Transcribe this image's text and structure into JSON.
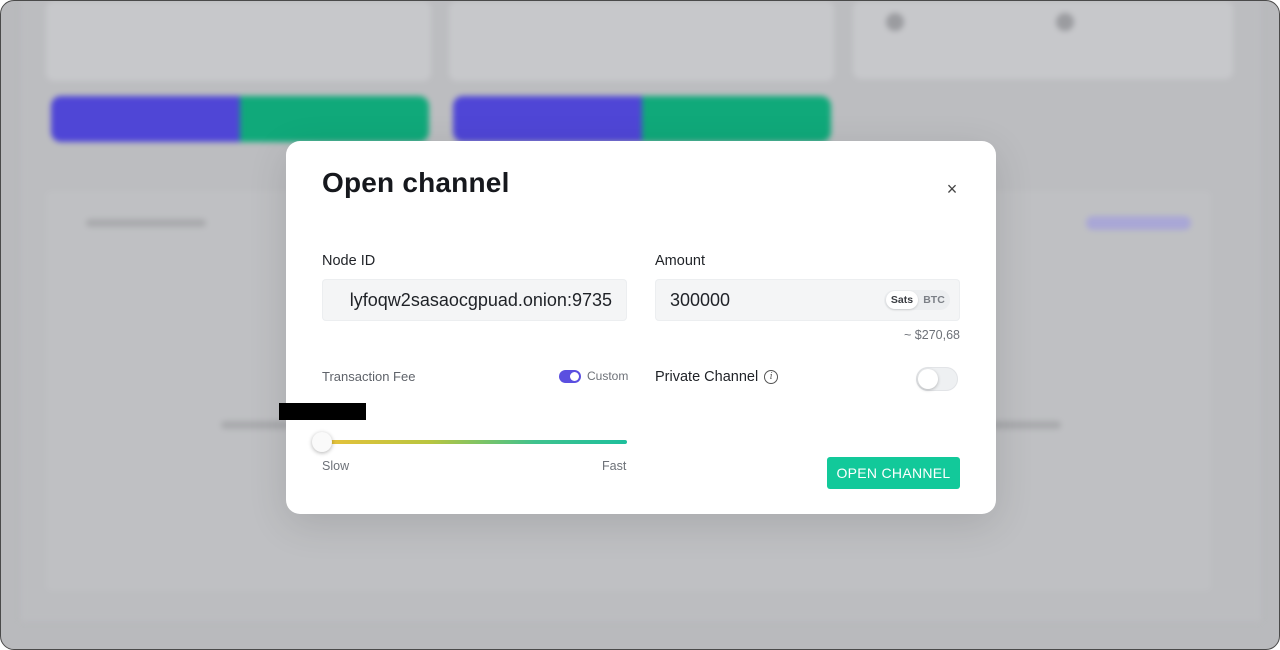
{
  "modal": {
    "title": "Open channel",
    "close_glyph": "×",
    "node_id": {
      "label": "Node ID",
      "value": "lyfoqw2sasaocgpuad.onion:9735"
    },
    "amount": {
      "label": "Amount",
      "value": "300000",
      "units": [
        "Sats",
        "BTC"
      ],
      "selected_unit": "Sats",
      "fiat_value": "~ $270,68"
    },
    "transaction_fee": {
      "label": "Transaction Fee",
      "custom_label": "Custom",
      "custom_enabled": true,
      "slider_position": 0,
      "slider_min_label": "Slow",
      "slider_max_label": "Fast"
    },
    "private_channel": {
      "label": "Private Channel",
      "info_glyph": "i",
      "enabled": false
    },
    "submit_label": "OPEN CHANNEL"
  },
  "colors": {
    "accent_green": "#12c99a",
    "toggle_purple": "#5b4fe0",
    "overlay": "#b9babd"
  },
  "icons": {
    "close": "close-icon",
    "info": "info-icon"
  }
}
